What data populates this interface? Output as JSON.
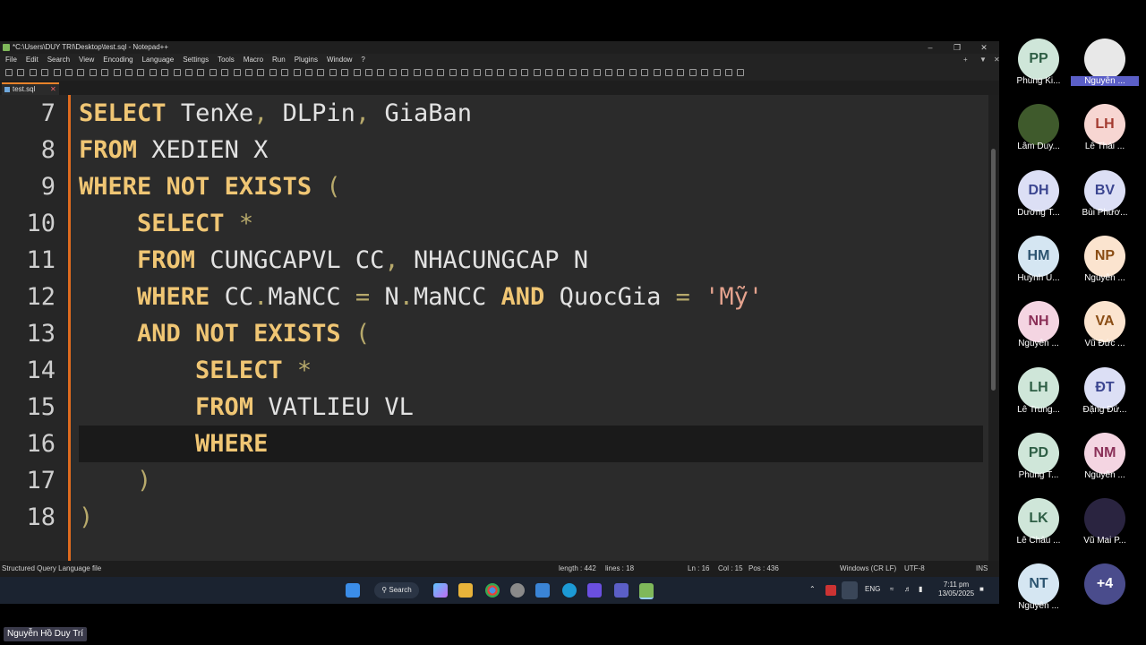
{
  "window": {
    "title": "*C:\\Users\\DUY TRI\\Desktop\\test.sql - Notepad++",
    "menu": [
      "File",
      "Edit",
      "Search",
      "View",
      "Encoding",
      "Language",
      "Settings",
      "Tools",
      "Macro",
      "Run",
      "Plugins",
      "Window",
      "?"
    ],
    "tab": "test.sql"
  },
  "editor": {
    "line_numbers": [
      "7",
      "8",
      "9",
      "10",
      "11",
      "12",
      "13",
      "14",
      "15",
      "16",
      "17",
      "18"
    ],
    "tokens": {
      "select": "SELECT",
      "tenxe": "TenXe",
      "comma": ",",
      "dlpin": "DLPin",
      "giaban": "GiaBan",
      "from": "FROM",
      "xedien_x": "XEDIEN X",
      "where": "WHERE",
      "not": "NOT",
      "exists": "EXISTS",
      "lparen": "(",
      "rparen": ")",
      "star": "*",
      "cungcapvl_cc": "CUNGCAPVL CC",
      "nhacungcap_n": "NHACUNGCAP N",
      "cc": "CC",
      "n": "N",
      "dot": ".",
      "mancc": "MaNCC",
      "eq": "=",
      "and": "AND",
      "quocgia": "QuocGia",
      "my_str": "'Mỹ'",
      "vatlieu_vl": "VATLIEU VL"
    }
  },
  "status": {
    "filetype": "Structured Query Language file",
    "length": "length : 442",
    "lines": "lines : 18",
    "ln": "Ln : 16",
    "col": "Col : 15",
    "pos": "Pos : 436",
    "eol": "Windows (CR LF)",
    "encoding": "UTF-8",
    "mode": "INS"
  },
  "taskbar": {
    "search_label": "Search",
    "lang": "ENG",
    "time": "7:11 pm",
    "date": "13/05/2025"
  },
  "participants": [
    {
      "initials": "PP",
      "name": "Phùng Ki...",
      "color": "#cfe6d9",
      "fg": "#2e5e45"
    },
    {
      "initials": "",
      "name": "Nguyễn ...",
      "color": "#e8e8e8",
      "fg": "#333"
    },
    {
      "initials": "",
      "name": "Lâm Duy...",
      "color": "#3f5a2c",
      "fg": "#fff"
    },
    {
      "initials": "LH",
      "name": "Lê Thái ...",
      "color": "#f7d6d2",
      "fg": "#a33a2f"
    },
    {
      "initials": "DH",
      "name": "Dương T...",
      "color": "#dcdff5",
      "fg": "#3b4590"
    },
    {
      "initials": "BV",
      "name": "Bùi Phươ...",
      "color": "#dcdff5",
      "fg": "#3b4590"
    },
    {
      "initials": "HM",
      "name": "Huỳnh U...",
      "color": "#d5e6f2",
      "fg": "#2c5470"
    },
    {
      "initials": "NP",
      "name": "Nguyễn ...",
      "color": "#fbe4cf",
      "fg": "#8a4d14"
    },
    {
      "initials": "NH",
      "name": "Nguyễn ...",
      "color": "#f4d5e2",
      "fg": "#8a2f57"
    },
    {
      "initials": "VA",
      "name": "Vũ Đức ...",
      "color": "#fbe4cf",
      "fg": "#8a4d14"
    },
    {
      "initials": "LH",
      "name": "Lê Trung...",
      "color": "#cfe6d9",
      "fg": "#2e5e45"
    },
    {
      "initials": "ĐT",
      "name": "Đặng Đứ...",
      "color": "#dcdff5",
      "fg": "#3b4590"
    },
    {
      "initials": "PD",
      "name": "Phùng T...",
      "color": "#cfe6d9",
      "fg": "#2e5e45"
    },
    {
      "initials": "NM",
      "name": "Nguyễn ...",
      "color": "#f4d5e2",
      "fg": "#8a2f57"
    },
    {
      "initials": "LK",
      "name": "Lê Châu ...",
      "color": "#cfe6d9",
      "fg": "#2e5e45"
    },
    {
      "initials": "",
      "name": "Vũ Mai P...",
      "color": "#2a2440",
      "fg": "#fff"
    },
    {
      "initials": "NT",
      "name": "Nguyễn ...",
      "color": "#d5e6f2",
      "fg": "#2c5470"
    },
    {
      "initials": "+4",
      "name": "",
      "color": "#4a4c8c",
      "fg": "#fff"
    }
  ],
  "speaker": "Nguyễn Hồ Duy Trí"
}
